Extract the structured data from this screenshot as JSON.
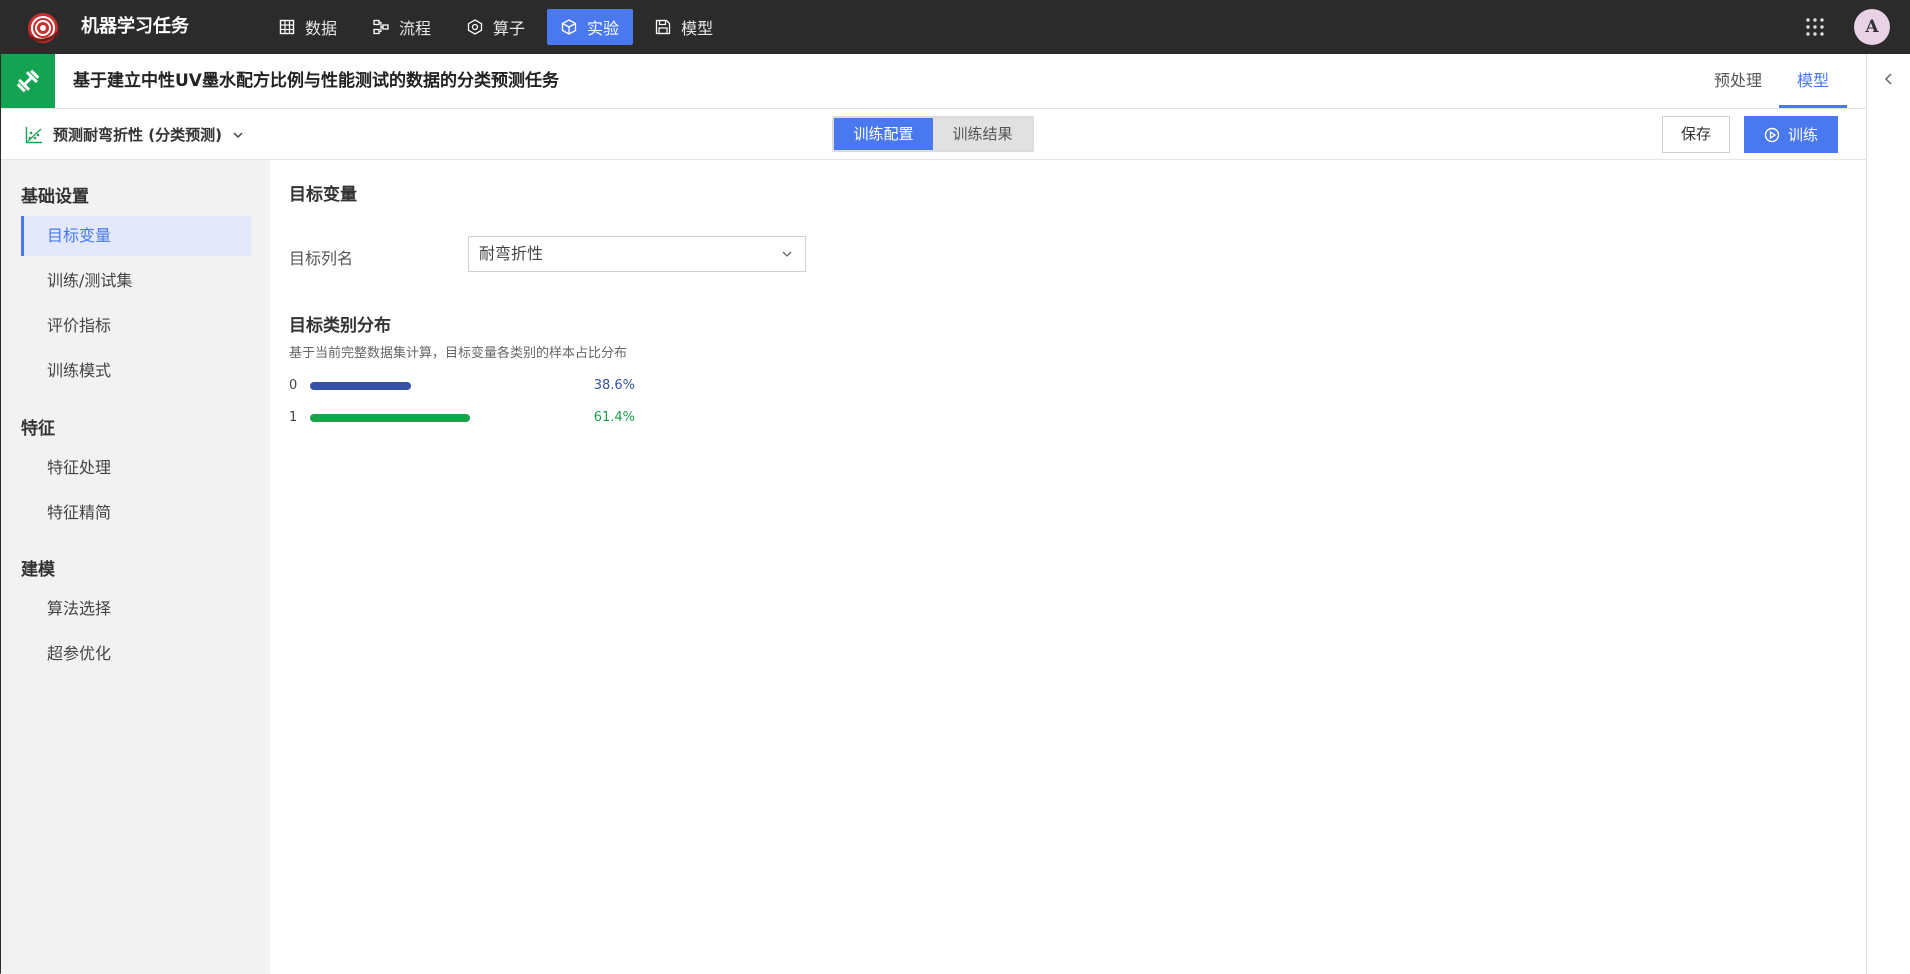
{
  "app": {
    "title": "机器学习任务",
    "avatar_letter": "A"
  },
  "nav": {
    "items": [
      {
        "label": "数据",
        "icon": "table-icon"
      },
      {
        "label": "流程",
        "icon": "flow-icon"
      },
      {
        "label": "算子",
        "icon": "operator-icon"
      },
      {
        "label": "实验",
        "icon": "cube-icon",
        "active": true
      },
      {
        "label": "模型",
        "icon": "save-icon"
      }
    ]
  },
  "task": {
    "title": "基于建立中性UV墨水配方比例与性能测试的数据的分类预测任务",
    "tabs": [
      {
        "label": "预处理"
      },
      {
        "label": "模型",
        "active": true
      }
    ]
  },
  "toolbar": {
    "model_label": "预测耐弯折性 (分类预测)",
    "segments": [
      {
        "label": "训练配置",
        "active": true
      },
      {
        "label": "训练结果"
      }
    ],
    "save_label": "保存",
    "train_label": "训练"
  },
  "sidebar": {
    "groups": [
      {
        "label": "基础设置",
        "items": [
          {
            "label": "目标变量",
            "active": true
          },
          {
            "label": "训练/测试集"
          },
          {
            "label": "评价指标"
          },
          {
            "label": "训练模式"
          }
        ]
      },
      {
        "label": "特征",
        "items": [
          {
            "label": "特征处理"
          },
          {
            "label": "特征精简"
          }
        ]
      },
      {
        "label": "建模",
        "items": [
          {
            "label": "算法选择"
          },
          {
            "label": "超参优化"
          }
        ]
      }
    ]
  },
  "main": {
    "section_title": "目标变量",
    "target_label": "目标列名",
    "target_value": "耐弯折性",
    "dist_title": "目标类别分布",
    "dist_desc": "基于当前完整数据集计算，目标变量各类别的样本占比分布",
    "distribution": [
      {
        "category": "0",
        "percent": 38.6,
        "percent_label": "38.6%",
        "color": "#3351a8"
      },
      {
        "category": "1",
        "percent": 61.4,
        "percent_label": "61.4%",
        "color": "#17a34a"
      }
    ]
  },
  "colors": {
    "accent": "#4a78ee",
    "topbar": "#2b2b2b",
    "task_badge": "#13a352"
  }
}
